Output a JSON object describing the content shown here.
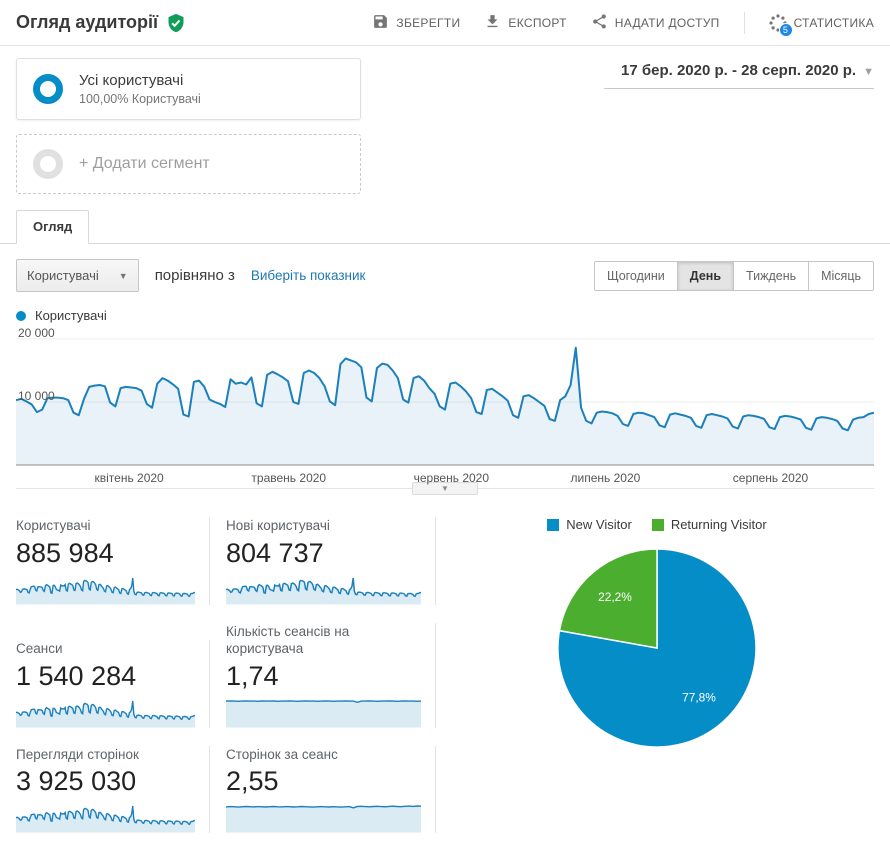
{
  "header": {
    "title": "Огляд аудиторії",
    "actions": [
      {
        "label": "ЗБЕРЕГТИ",
        "icon": "save-icon"
      },
      {
        "label": "ЕКСПОРТ",
        "icon": "export-icon"
      },
      {
        "label": "НАДАТИ ДОСТУП",
        "icon": "share-icon"
      },
      {
        "label": "СТАТИСТИКА",
        "icon": "insights-icon",
        "badge": "5"
      }
    ]
  },
  "segments": {
    "active_title": "Усі користувачі",
    "active_subtitle": "100,00% Користувачі",
    "add_label": "+ Додати сегмент"
  },
  "date_range": "17 бер. 2020 р. - 28 серп. 2020 р.",
  "tab": "Огляд",
  "controls": {
    "metric_select": "Користувачі",
    "compare_text": "порівняно з",
    "pick_metric_link": "Виберіть показник",
    "granularity": [
      {
        "label": "Щогодини",
        "active": false
      },
      {
        "label": "День",
        "active": true
      },
      {
        "label": "Тиждень",
        "active": false
      },
      {
        "label": "Місяць",
        "active": false
      }
    ]
  },
  "legend_label": "Користувачі",
  "chart_data": [
    {
      "type": "line",
      "name": "users-by-day",
      "title": "Користувачі",
      "date_start": "17 бер. 2020",
      "date_end": "28 серп. 2020",
      "ylim": [
        0,
        20000
      ],
      "grid": true,
      "y_ticks": [
        {
          "value": 20000,
          "label": "20 000"
        },
        {
          "value": 10000,
          "label": "10 000"
        }
      ],
      "month_ticks": [
        {
          "day_index": 15,
          "label": "квітень 2020"
        },
        {
          "day_index": 45,
          "label": "травень 2020"
        },
        {
          "day_index": 76,
          "label": "червень 2020"
        },
        {
          "day_index": 106,
          "label": "липень 2020"
        },
        {
          "day_index": 137,
          "label": "серпень 2020"
        }
      ],
      "values": [
        10300,
        10500,
        10100,
        9600,
        8400,
        8800,
        10600,
        10700,
        10700,
        10600,
        10300,
        8300,
        7900,
        10500,
        12400,
        12600,
        12700,
        12500,
        9900,
        9300,
        12200,
        12400,
        12300,
        12200,
        11800,
        9700,
        9100,
        12900,
        13800,
        13400,
        12800,
        12100,
        8000,
        7700,
        13200,
        13400,
        12400,
        10400,
        10000,
        9700,
        9200,
        13600,
        12900,
        13100,
        12800,
        13900,
        9800,
        9300,
        14300,
        14800,
        14400,
        13900,
        13300,
        10000,
        9700,
        14600,
        15000,
        14600,
        13800,
        12500,
        10100,
        9500,
        16000,
        16900,
        16600,
        16300,
        15500,
        10700,
        10100,
        15400,
        16100,
        15900,
        15000,
        13800,
        10400,
        9900,
        13800,
        14100,
        13400,
        12200,
        11300,
        9300,
        8800,
        12900,
        13100,
        12500,
        11700,
        10600,
        8400,
        8100,
        11900,
        12100,
        11500,
        10900,
        10200,
        7900,
        7500,
        10900,
        11100,
        10600,
        10000,
        9400,
        7300,
        7000,
        10300,
        10900,
        12700,
        18600,
        9100,
        7000,
        6600,
        8300,
        8500,
        8400,
        8200,
        7800,
        6500,
        6200,
        8100,
        8300,
        8200,
        7900,
        7600,
        6300,
        6000,
        8000,
        8200,
        8000,
        7800,
        7500,
        6200,
        5900,
        7900,
        8100,
        7900,
        7700,
        7400,
        6100,
        5800,
        7700,
        7900,
        7800,
        7600,
        7300,
        6000,
        5700,
        7600,
        7800,
        7700,
        7500,
        7200,
        5900,
        5600,
        7400,
        7600,
        7500,
        7300,
        7000,
        5800,
        5500,
        7200,
        7500,
        7600,
        8100,
        8300
      ]
    },
    {
      "type": "pie",
      "name": "visitor-type-share",
      "legend": [
        {
          "label": "New Visitor",
          "color": "#058dc7"
        },
        {
          "label": "Returning Visitor",
          "color": "#4cae2e"
        }
      ],
      "slices": [
        {
          "label": "77,8%",
          "value": 77.8,
          "color": "#058dc7"
        },
        {
          "label": "22,2%",
          "value": 22.2,
          "color": "#4cae2e"
        }
      ]
    },
    {
      "type": "sparkline-set",
      "ratio_174": [
        1.74,
        1.75,
        1.74,
        1.73,
        1.74,
        1.75,
        1.74,
        1.74,
        1.73,
        1.75,
        1.74,
        1.74,
        1.75,
        1.73,
        1.74,
        1.74,
        1.75,
        1.74,
        1.73,
        1.74,
        1.75,
        1.74,
        1.74,
        1.73,
        1.74,
        1.75,
        1.74,
        1.73,
        1.74,
        1.74,
        1.75,
        1.74,
        1.74,
        1.66,
        1.74,
        1.74,
        1.75,
        1.74,
        1.73,
        1.74,
        1.74,
        1.75,
        1.74,
        1.73,
        1.74,
        1.75,
        1.74,
        1.74,
        1.73,
        1.74
      ],
      "ratio_255": [
        2.52,
        2.55,
        2.54,
        2.5,
        2.53,
        2.56,
        2.54,
        2.52,
        2.55,
        2.53,
        2.51,
        2.54,
        2.56,
        2.53,
        2.52,
        2.55,
        2.54,
        2.51,
        2.53,
        2.56,
        2.54,
        2.52,
        2.5,
        2.53,
        2.55,
        2.53,
        2.51,
        2.54,
        2.52,
        2.5,
        2.53,
        2.55,
        2.42,
        2.56,
        2.58,
        2.55,
        2.53,
        2.56,
        2.58,
        2.55,
        2.53,
        2.57,
        2.59,
        2.56,
        2.54,
        2.58,
        2.6,
        2.57,
        2.61,
        2.59
      ]
    }
  ],
  "metrics": [
    {
      "label": "Користувачі",
      "value": "885 984",
      "spark": "main"
    },
    {
      "label": "Нові користувачі",
      "value": "804 737",
      "spark": "main"
    },
    {
      "label": "Сеанси",
      "value": "1 540 284",
      "spark": "main"
    },
    {
      "label": "Кількість сеансів на користувача",
      "value": "1,74",
      "spark": "ratio_174"
    },
    {
      "label": "Перегляди сторінок",
      "value": "3 925 030",
      "spark": "main"
    },
    {
      "label": "Сторінок за сеанс",
      "value": "2,55",
      "spark": "ratio_255"
    }
  ],
  "colors": {
    "accent_blue": "#058dc7",
    "line_blue": "#1c80bc",
    "green": "#4cae2e",
    "link_blue": "#1f78b4",
    "badge_blue": "#1e88e5",
    "shield_green": "#0f9d58"
  }
}
